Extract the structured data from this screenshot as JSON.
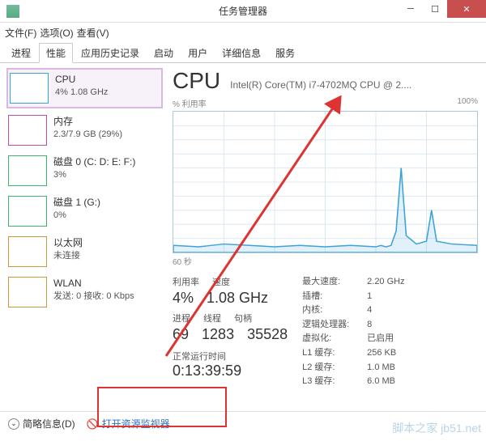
{
  "titlebar": {
    "title": "任务管理器"
  },
  "menubar": {
    "file": "文件(F)",
    "options": "选项(O)",
    "view": "查看(V)"
  },
  "tabs": [
    "进程",
    "性能",
    "应用历史记录",
    "启动",
    "用户",
    "详细信息",
    "服务"
  ],
  "sidebar": [
    {
      "name": "CPU",
      "sub": "4% 1.08 GHz",
      "color": "cpu",
      "active": true
    },
    {
      "name": "内存",
      "sub": "2.3/7.9 GB (29%)",
      "color": "mem"
    },
    {
      "name": "磁盘 0 (C: D: E: F:)",
      "sub": "3%",
      "color": "disk"
    },
    {
      "name": "磁盘 1 (G:)",
      "sub": "0%",
      "color": "disk"
    },
    {
      "name": "以太网",
      "sub": "未连接",
      "color": "net"
    },
    {
      "name": "WLAN",
      "sub": "发送: 0 接收: 0 Kbps",
      "color": "wlan"
    }
  ],
  "main": {
    "title": "CPU",
    "model": "Intel(R) Core(TM) i7-4702MQ CPU @ 2....",
    "chart_top_left": "% 利用率",
    "chart_top_right": "100%",
    "chart_bottom": "60 秒",
    "row1_labels": [
      "利用率",
      "速度"
    ],
    "row1_values": [
      "4%",
      "1.08 GHz"
    ],
    "row2_labels": [
      "进程",
      "线程",
      "句柄"
    ],
    "row2_values": [
      "69",
      "1283",
      "35528"
    ],
    "uptime_label": "正常运行时间",
    "uptime_value": "0:13:39:59",
    "right": [
      [
        "最大速度:",
        "2.20 GHz"
      ],
      [
        "插槽:",
        "1"
      ],
      [
        "内核:",
        "4"
      ],
      [
        "逻辑处理器:",
        "8"
      ],
      [
        "虚拟化:",
        "已启用"
      ],
      [
        "L1 缓存:",
        "256 KB"
      ],
      [
        "L2 缓存:",
        "1.0 MB"
      ],
      [
        "L3 缓存:",
        "6.0 MB"
      ]
    ]
  },
  "footer": {
    "less": "简略信息(D)",
    "resmon": "打开资源监视器"
  },
  "chart_data": {
    "type": "line",
    "title": "% 利用率",
    "xlabel": "60 秒",
    "ylabel": "% 利用率",
    "ylim": [
      0,
      100
    ],
    "x": [
      0,
      5,
      10,
      15,
      20,
      25,
      30,
      35,
      40,
      41,
      42,
      43,
      44,
      45,
      46,
      48,
      50,
      51,
      52,
      55,
      60
    ],
    "values": [
      5,
      4,
      6,
      5,
      4,
      5,
      4,
      5,
      4,
      5,
      4,
      5,
      15,
      60,
      12,
      6,
      8,
      30,
      8,
      6,
      5
    ]
  },
  "watermark": "脚本之家 jb51.net"
}
